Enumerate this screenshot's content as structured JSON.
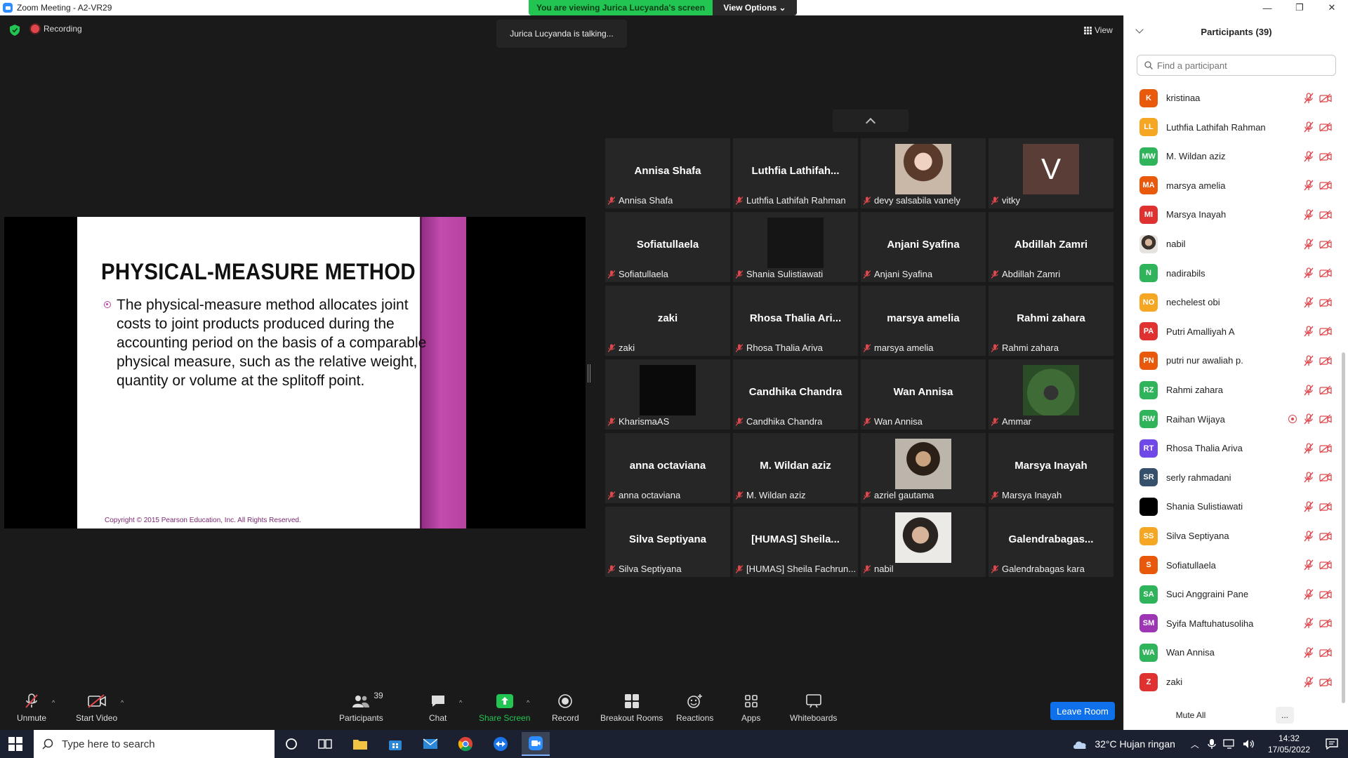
{
  "window": {
    "title": "Zoom Meeting - A2-VR29",
    "minimize": "—",
    "maximize": "❐",
    "close": "✕"
  },
  "banner": {
    "viewing_text": "You are viewing Jurica Lucyanda's screen",
    "view_options": "View Options ⌄"
  },
  "status": {
    "recording": "Recording",
    "talking": "Jurica Lucyanda is talking...",
    "view": "View"
  },
  "slide": {
    "title": "PHYSICAL-MEASURE METHOD",
    "body": "The physical-measure method allocates joint costs to joint products produced during the accounting period on the basis of a comparable physical measure, such as the relative weight, quantity or volume at the splitoff point.",
    "copyright": "Copyright © 2015 Pearson Education, Inc. All Rights Reserved."
  },
  "gallery": [
    {
      "big": "Annisa Shafa",
      "label": "Annisa Shafa"
    },
    {
      "big": "Luthfia  Lathifah...",
      "label": "Luthfia Lathifah Rahman"
    },
    {
      "big": "",
      "label": "devy salsabila vanely",
      "avatar": "photo1"
    },
    {
      "big": "",
      "label": "vitky",
      "avatar": "v",
      "avatar_letter": "V"
    },
    {
      "big": "Sofiatullaela",
      "label": "Sofiatullaela"
    },
    {
      "big": "",
      "label": "Shania Sulistiawati",
      "avatar": "dark"
    },
    {
      "big": "Anjani Syafina",
      "label": "Anjani Syafina"
    },
    {
      "big": "Abdillah Zamri",
      "label": "Abdillah Zamri"
    },
    {
      "big": "zaki",
      "label": "zaki"
    },
    {
      "big": "Rhosa Thalia Ari...",
      "label": "Rhosa Thalia Ariva"
    },
    {
      "big": "marsya amelia",
      "label": "marsya amelia"
    },
    {
      "big": "Rahmi zahara",
      "label": "Rahmi zahara"
    },
    {
      "big": "",
      "label": "KharismaAS",
      "avatar": "dark2"
    },
    {
      "big": "Candhika Chandra",
      "label": "Candhika Chandra"
    },
    {
      "big": "Wan Annisa",
      "label": "Wan Annisa"
    },
    {
      "big": "",
      "label": "Ammar",
      "avatar": "photo4"
    },
    {
      "big": "anna octaviana",
      "label": "anna octaviana"
    },
    {
      "big": "M. Wildan aziz",
      "label": "M. Wildan aziz"
    },
    {
      "big": "",
      "label": "azriel gautama",
      "avatar": "photo2"
    },
    {
      "big": "Marsya Inayah",
      "label": "Marsya Inayah"
    },
    {
      "big": "Silva Septiyana",
      "label": "Silva Septiyana"
    },
    {
      "big": "[HUMAS]  Sheila...",
      "label": "[HUMAS] Sheila Fachrun..."
    },
    {
      "big": "",
      "label": "nabil",
      "avatar": "photo3"
    },
    {
      "big": "Galendrabagas...",
      "label": "Galendrabagas kara"
    }
  ],
  "toolbar": {
    "unmute": "Unmute",
    "start_video": "Start Video",
    "participants": "Participants",
    "participants_count": "39",
    "chat": "Chat",
    "share_screen": "Share Screen",
    "record": "Record",
    "breakout": "Breakout Rooms",
    "reactions": "Reactions",
    "apps": "Apps",
    "whiteboards": "Whiteboards",
    "leave": "Leave Room"
  },
  "panel": {
    "title": "Participants (39)",
    "search_placeholder": "Find a participant",
    "mute_all": "Mute All",
    "more": "...",
    "participants": [
      {
        "initials": "K",
        "name": "kristinaa",
        "color": "#e8590c"
      },
      {
        "initials": "LL",
        "name": "Luthfia Lathifah Rahman",
        "color": "#f5a623"
      },
      {
        "initials": "MW",
        "name": "M. Wildan aziz",
        "color": "#2fb35b"
      },
      {
        "initials": "MA",
        "name": "marsya amelia",
        "color": "#e8590c"
      },
      {
        "initials": "MI",
        "name": "Marsya Inayah",
        "color": "#e03131"
      },
      {
        "initials": "",
        "name": "nabil",
        "color": "#8c8c8c",
        "photo": true
      },
      {
        "initials": "N",
        "name": "nadirabils",
        "color": "#2fb35b"
      },
      {
        "initials": "NO",
        "name": "nechelest obi",
        "color": "#f5a623"
      },
      {
        "initials": "PA",
        "name": "Putri Amalliyah A",
        "color": "#e03131"
      },
      {
        "initials": "PN",
        "name": "putri nur awaliah p.",
        "color": "#e8590c"
      },
      {
        "initials": "RZ",
        "name": "Rahmi zahara",
        "color": "#2fb35b"
      },
      {
        "initials": "RW",
        "name": "Raihan Wijaya",
        "color": "#2fb35b",
        "recording": true
      },
      {
        "initials": "RT",
        "name": "Rhosa Thalia Ariva",
        "color": "#7048e8"
      },
      {
        "initials": "SR",
        "name": "serly rahmadani",
        "color": "#364f6b"
      },
      {
        "initials": "",
        "name": "Shania Sulistiawati",
        "color": "#000000"
      },
      {
        "initials": "SS",
        "name": "Silva Septiyana",
        "color": "#f5a623"
      },
      {
        "initials": "S",
        "name": "Sofiatullaela",
        "color": "#e8590c"
      },
      {
        "initials": "SA",
        "name": "Suci Anggraini Pane",
        "color": "#2fb35b"
      },
      {
        "initials": "SM",
        "name": "Syifa Maftuhatusoliha",
        "color": "#9c36b5"
      },
      {
        "initials": "WA",
        "name": "Wan Annisa",
        "color": "#2fb35b"
      },
      {
        "initials": "Z",
        "name": "zaki",
        "color": "#e03131"
      }
    ]
  },
  "taskbar": {
    "search_placeholder": "Type here to search",
    "weather": "32°C  Hujan ringan",
    "time": "14:32",
    "date": "17/05/2022"
  }
}
